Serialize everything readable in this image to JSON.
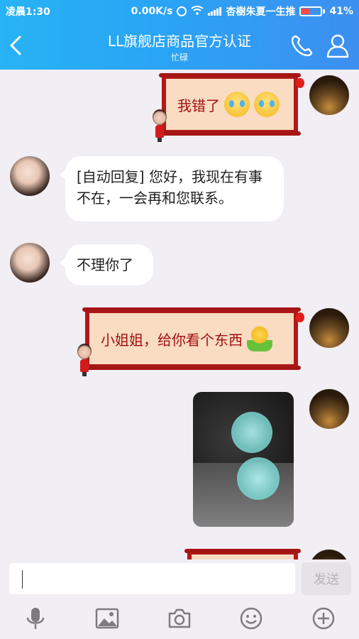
{
  "statusbar": {
    "time": "凌晨1:30",
    "speed": "0.00K/s",
    "carrier": "杏樹朱夏一生推",
    "battery": "41%"
  },
  "header": {
    "title": "LL旗舰店商品官方认证",
    "subtitle": "忙碌"
  },
  "messages": {
    "m1": "我错了",
    "m2": "[自动回复] 您好，我现在有事不在，一会再和您联系。",
    "m3": "不理你了",
    "m4": "小姐姐，给你看个东西"
  },
  "input": {
    "send_label": "发送"
  },
  "colors": {
    "header_start": "#27b3f5",
    "header_end": "#3d8ff0",
    "scroll_bg": "#f9dcc2",
    "scroll_border": "#b01818",
    "chat_bg": "#f1eef4"
  },
  "icons": [
    "back-arrow-icon",
    "phone-icon",
    "profile-icon",
    "microphone-icon",
    "image-icon",
    "camera-icon",
    "smiley-icon",
    "plus-icon"
  ]
}
